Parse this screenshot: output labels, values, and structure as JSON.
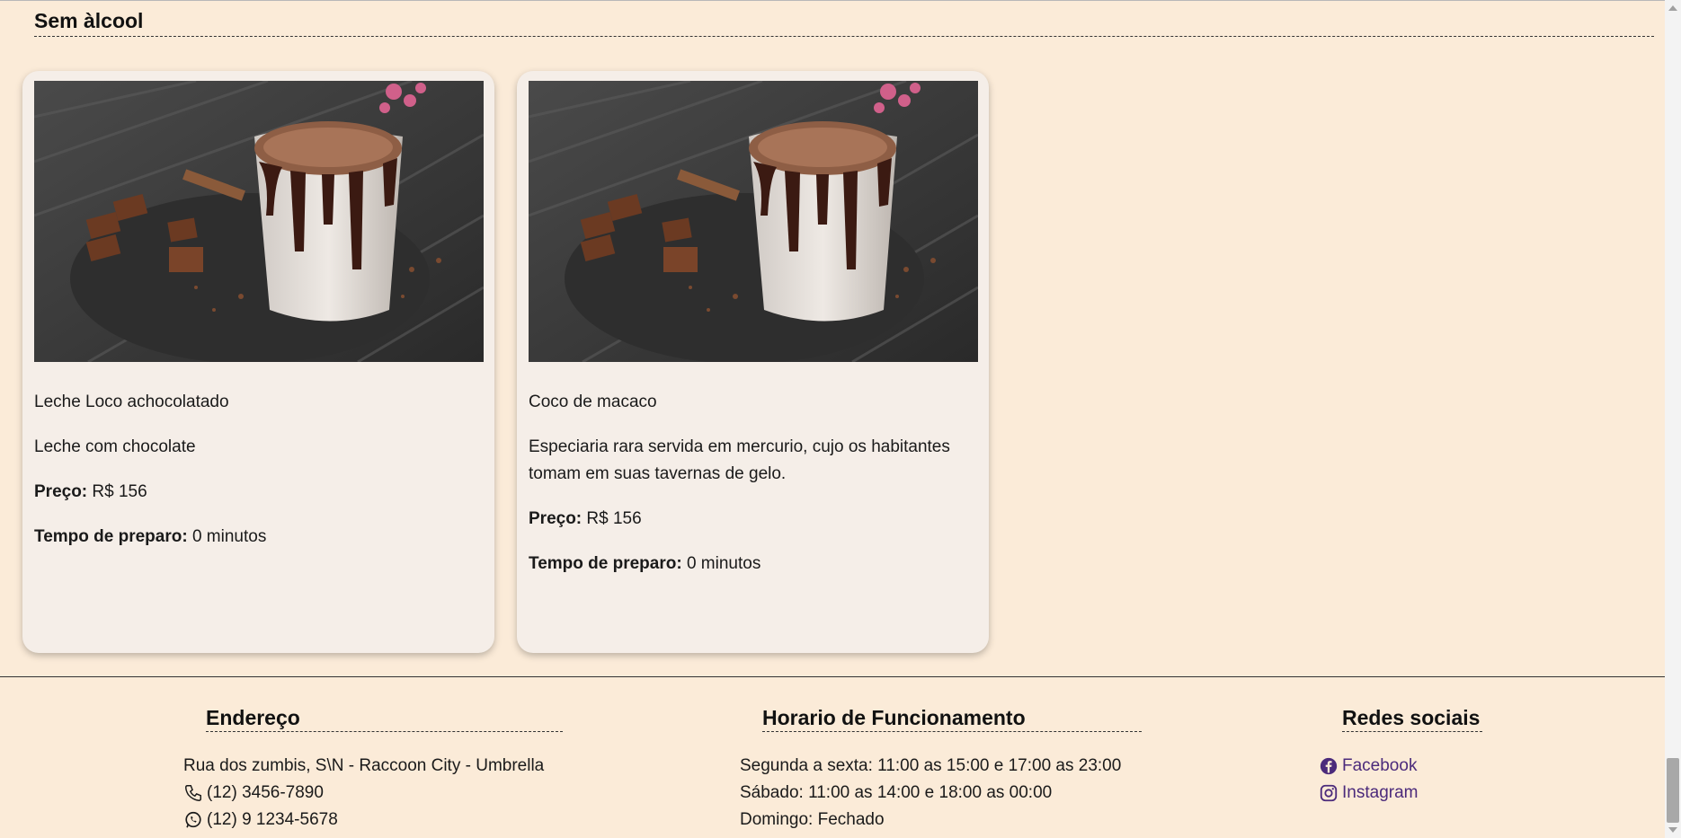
{
  "section": {
    "title": "Sem àlcool"
  },
  "cards": [
    {
      "name": "Leche Loco achocolatado",
      "description": "Leche com chocolate",
      "price_label": "Preço:",
      "price_value": " R$ 156",
      "time_label": "Tempo de preparo:",
      "time_value": " 0 minutos",
      "image": "hot-chocolate-cup-photo"
    },
    {
      "name": "Coco de macaco",
      "description": "Especiaria rara servida em mercurio, cujo os habitantes tomam em suas tavernas de gelo.",
      "price_label": "Preço:",
      "price_value": " R$ 156",
      "time_label": "Tempo de preparo:",
      "time_value": " 0 minutos",
      "image": "hot-chocolate-cup-photo"
    }
  ],
  "footer": {
    "address": {
      "title": "Endereço",
      "street": "Rua dos zumbis, S\\N - Raccoon City - Umbrella",
      "phone": "(12) 3456-7890",
      "whatsapp": "(12) 9 1234-5678"
    },
    "hours": {
      "title": "Horario de Funcionamento",
      "weekdays": "Segunda a sexta: 11:00 as 15:00 e 17:00 as 23:00",
      "saturday": "Sábado: 11:00 as 14:00 e 18:00 as 00:00",
      "sunday": "Domingo: Fechado"
    },
    "social": {
      "title": "Redes sociais",
      "facebook": "Facebook",
      "instagram": "Instagram"
    }
  },
  "colors": {
    "background": "#fbebd8",
    "card": "#f5eee8",
    "link": "#4b2a7b"
  }
}
